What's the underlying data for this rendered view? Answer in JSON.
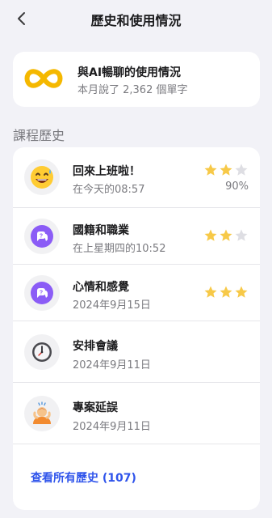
{
  "header": {
    "title": "歷史和使用情況",
    "back_icon": "chevron-left-icon"
  },
  "usage": {
    "title": "與AI暢聊的使用情況",
    "subtitle": "本月說了 2,362 個單字",
    "icon": "infinity-icon",
    "icon_color": "#f5b800"
  },
  "history": {
    "section_title": "課程歷史",
    "items": [
      {
        "title": "回來上班啦！",
        "date": "在今天的08:57",
        "icon": "sweat-smile-emoji-icon",
        "rating": 2,
        "rating_max": 3,
        "score": "90%"
      },
      {
        "title": "國籍和職業",
        "date": "在上星期四的10:52",
        "icon": "chat-bubble-icon",
        "rating": 2,
        "rating_max": 3
      },
      {
        "title": "心情和感覺",
        "date": "2024年9月15日",
        "icon": "chat-bubble-icon",
        "rating": 3,
        "rating_max": 3
      },
      {
        "title": "安排會議",
        "date": "2024年9月11日",
        "icon": "clock-icon"
      },
      {
        "title": "專案延誤",
        "date": "2024年9月11日",
        "icon": "stressed-person-icon"
      }
    ],
    "view_all": "查看所有歷史 (107)"
  },
  "colors": {
    "accent": "#2f54eb",
    "star_filled": "#f7c948",
    "star_empty": "#dedee3",
    "bubble_purple": "#8b5cf6"
  }
}
